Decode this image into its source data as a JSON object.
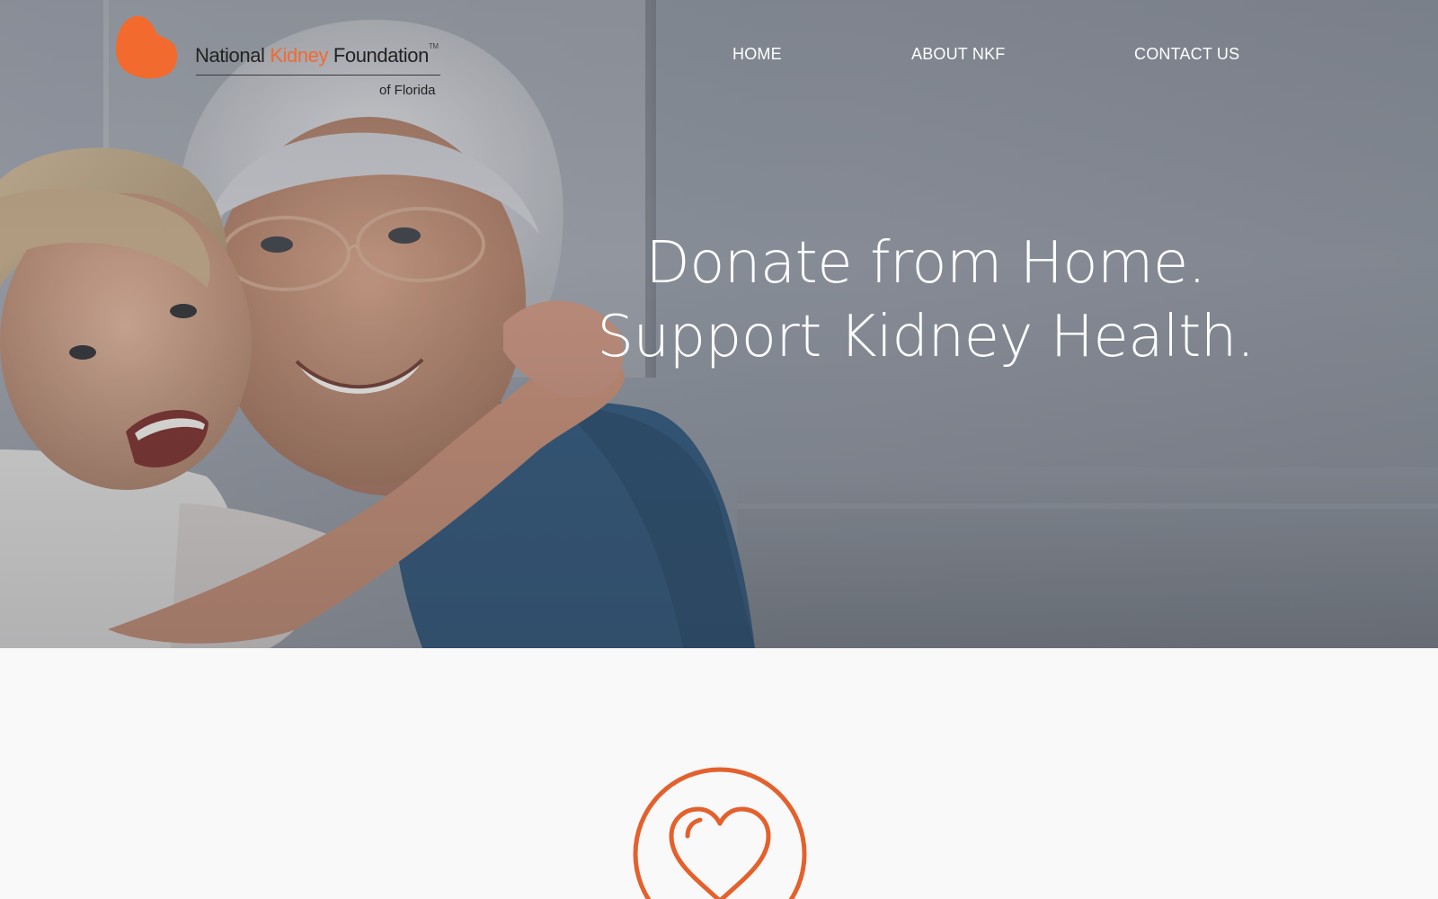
{
  "brand": {
    "name_part1": "National ",
    "name_part2": "Kidney",
    "name_part3": " Foundation",
    "trademark": "TM",
    "subtitle": "of Florida",
    "accent_color": "#f26a2e"
  },
  "nav": {
    "items": [
      {
        "label": "HOME"
      },
      {
        "label": "ABOUT NKF"
      },
      {
        "label": "CONTACT US"
      }
    ]
  },
  "hero": {
    "headline_line1": "Donate from Home.",
    "headline_line2": "Support Kidney Health.",
    "image_description": "smiling-grandmother-hugging-child-photo"
  },
  "features": {
    "icon": "heart-icon",
    "icon_color": "#e4602c"
  }
}
